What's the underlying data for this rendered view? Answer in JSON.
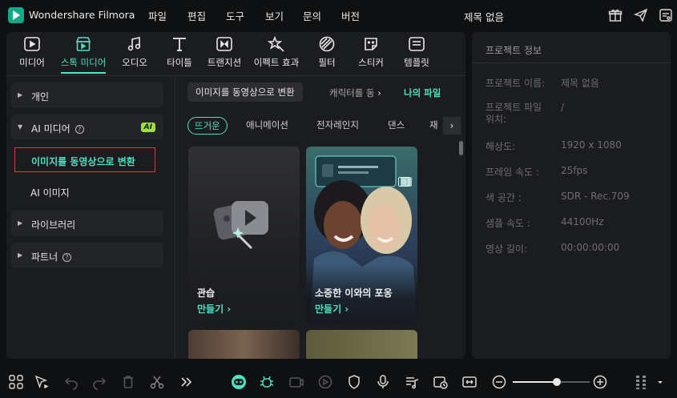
{
  "app": {
    "name": "Wondershare Filmora",
    "document_title": "제목 없음"
  },
  "menu": [
    "파일",
    "편집",
    "도구",
    "보기",
    "문의",
    "버전"
  ],
  "toolbar": {
    "items": [
      {
        "label": "미디어",
        "icon": "media-icon"
      },
      {
        "label": "스톡 미디어",
        "icon": "stock-media-icon",
        "active": true
      },
      {
        "label": "오디오",
        "icon": "audio-icon"
      },
      {
        "label": "타이틀",
        "icon": "title-icon"
      },
      {
        "label": "트랜지션",
        "icon": "transition-icon"
      },
      {
        "label": "이펙트 효과",
        "icon": "effects-icon"
      },
      {
        "label": "필터",
        "icon": "filter-icon"
      },
      {
        "label": "스티커",
        "icon": "sticker-icon"
      },
      {
        "label": "템플릿",
        "icon": "template-icon"
      }
    ]
  },
  "sidebar": {
    "personal": "개인",
    "ai_media": "AI 미디어",
    "ai_badge": "AI",
    "img_to_video": "이미지를 동영상으로 변환",
    "ai_image": "AI 이미지",
    "library": "라이브러리",
    "partner": "파트너"
  },
  "content_tabs": {
    "active": "이미지를 동영상으로 변환",
    "second": "캐릭터를 동",
    "my_files": "나의 파일"
  },
  "chips": [
    "뜨거운",
    "애니메이션",
    "전자레인지",
    "댄스",
    "재"
  ],
  "cards": [
    {
      "title": "관습",
      "action": "만들기 ›"
    },
    {
      "title": "소중한 이와의 포옹",
      "action": "만들기 ›"
    }
  ],
  "project_info": {
    "header": "프로젝트 정보",
    "rows": [
      {
        "label": "프로젝트 이름:",
        "value": "제목 없음"
      },
      {
        "label": "프로젝트 파일\n위치:",
        "value": "/"
      },
      {
        "label": "해상도:",
        "value": "1920 x 1080"
      },
      {
        "label": "프레임 속도 :",
        "value": "25fps"
      },
      {
        "label": "색 공간 :",
        "value": "SDR - Rec.709"
      },
      {
        "label": "샘플 속도 :",
        "value": "44100Hz"
      },
      {
        "label": "영상 길이:",
        "value": "00:00:00:00"
      }
    ]
  },
  "timeline": {
    "zoom_fraction": 0.57
  },
  "colors": {
    "accent": "#4fe0c0",
    "ai_badge": "#9be13c",
    "selection_border": "#e03a3a"
  }
}
